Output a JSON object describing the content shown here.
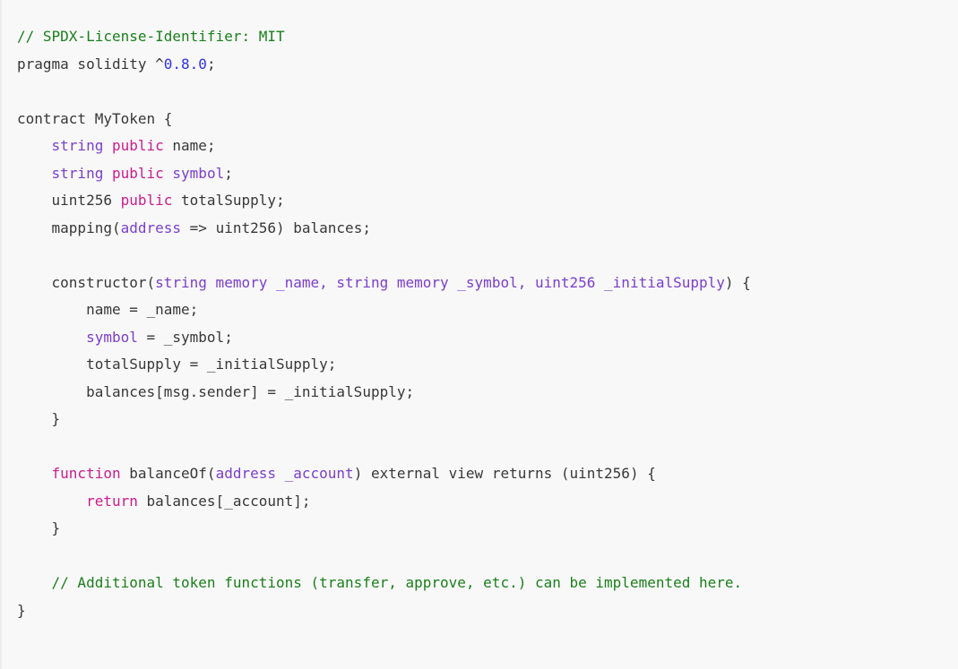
{
  "document": {
    "kind": "code-snippet",
    "language": "solidity",
    "background_color": "#f8f8f8",
    "palette": {
      "plain": "#383838",
      "comment": "#1a7f1a",
      "keyword": "#cc1b8d",
      "type": "#7a3fcc",
      "number": "#3030ee"
    },
    "font_size_px": 16,
    "line_height_px": 30.5,
    "right_clipped": true,
    "lines": [
      {
        "n": 1,
        "indent": 0,
        "text": "// SPDX-License-Identifier: MIT",
        "tokens": [
          {
            "t": "// SPDX-License-Identifier: MIT",
            "c": "cmt"
          }
        ]
      },
      {
        "n": 2,
        "indent": 0,
        "text": "pragma solidity ^0.8.0;",
        "tokens": [
          {
            "t": "pragma solidity ^",
            "c": "pln"
          },
          {
            "t": "0.8.0",
            "c": "num"
          },
          {
            "t": ";",
            "c": "pln"
          }
        ]
      },
      {
        "n": 3,
        "indent": 0,
        "text": "",
        "tokens": []
      },
      {
        "n": 4,
        "indent": 0,
        "text": "contract MyToken {",
        "tokens": [
          {
            "t": "contract MyToken {",
            "c": "pln"
          }
        ]
      },
      {
        "n": 5,
        "indent": 4,
        "text": "    string public name;",
        "tokens": [
          {
            "t": "    ",
            "c": "pln"
          },
          {
            "t": "string",
            "c": "typ"
          },
          {
            "t": " ",
            "c": "pln"
          },
          {
            "t": "public",
            "c": "kw"
          },
          {
            "t": " name;",
            "c": "pln"
          }
        ]
      },
      {
        "n": 6,
        "indent": 4,
        "text": "    string public symbol;",
        "tokens": [
          {
            "t": "    ",
            "c": "pln"
          },
          {
            "t": "string",
            "c": "typ"
          },
          {
            "t": " ",
            "c": "pln"
          },
          {
            "t": "public",
            "c": "kw"
          },
          {
            "t": " ",
            "c": "pln"
          },
          {
            "t": "symbol",
            "c": "typ"
          },
          {
            "t": ";",
            "c": "pln"
          }
        ]
      },
      {
        "n": 7,
        "indent": 4,
        "text": "    uint256 public totalSupply;",
        "tokens": [
          {
            "t": "    uint256 ",
            "c": "pln"
          },
          {
            "t": "public",
            "c": "kw"
          },
          {
            "t": " totalSupply;",
            "c": "pln"
          }
        ]
      },
      {
        "n": 8,
        "indent": 4,
        "text": "    mapping(address => uint256) balances;",
        "tokens": [
          {
            "t": "    mapping(",
            "c": "pln"
          },
          {
            "t": "address",
            "c": "typ"
          },
          {
            "t": " => uint256) balances;",
            "c": "pln"
          }
        ]
      },
      {
        "n": 9,
        "indent": 0,
        "text": "",
        "tokens": []
      },
      {
        "n": 10,
        "indent": 4,
        "text": "    constructor(string memory _name, string memory _symbol, uint256 _initialSupply) {",
        "tokens": [
          {
            "t": "    constructor(",
            "c": "pln"
          },
          {
            "t": "string memory _name",
            "c": "typ"
          },
          {
            "t": ", ",
            "c": "typ"
          },
          {
            "t": "string memory _symbol, uint256 _initialSupply",
            "c": "typ"
          },
          {
            "t": ") {",
            "c": "pln"
          }
        ]
      },
      {
        "n": 11,
        "indent": 8,
        "text": "        name = _name;",
        "tokens": [
          {
            "t": "        name = _name;",
            "c": "pln"
          }
        ]
      },
      {
        "n": 12,
        "indent": 8,
        "text": "        symbol = _symbol;",
        "tokens": [
          {
            "t": "        ",
            "c": "pln"
          },
          {
            "t": "symbol",
            "c": "typ"
          },
          {
            "t": " = _symbol;",
            "c": "pln"
          }
        ]
      },
      {
        "n": 13,
        "indent": 8,
        "text": "        totalSupply = _initialSupply;",
        "tokens": [
          {
            "t": "        totalSupply = _initialSupply;",
            "c": "pln"
          }
        ]
      },
      {
        "n": 14,
        "indent": 8,
        "text": "        balances[msg.sender] = _initialSupply;",
        "tokens": [
          {
            "t": "        balances[msg.sender] = _initialSupply;",
            "c": "pln"
          }
        ]
      },
      {
        "n": 15,
        "indent": 4,
        "text": "    }",
        "tokens": [
          {
            "t": "    }",
            "c": "pln"
          }
        ]
      },
      {
        "n": 16,
        "indent": 0,
        "text": "",
        "tokens": []
      },
      {
        "n": 17,
        "indent": 4,
        "text": "    function balanceOf(address _account) external view returns (uint256) {",
        "tokens": [
          {
            "t": "    ",
            "c": "pln"
          },
          {
            "t": "function",
            "c": "kw"
          },
          {
            "t": " balanceOf(",
            "c": "pln"
          },
          {
            "t": "address _account",
            "c": "typ"
          },
          {
            "t": ") external view returns (uint256) {",
            "c": "pln"
          }
        ]
      },
      {
        "n": 18,
        "indent": 8,
        "text": "        return balances[_account];",
        "tokens": [
          {
            "t": "        ",
            "c": "pln"
          },
          {
            "t": "return",
            "c": "kw"
          },
          {
            "t": " balances[_account];",
            "c": "pln"
          }
        ]
      },
      {
        "n": 19,
        "indent": 4,
        "text": "    }",
        "tokens": [
          {
            "t": "    }",
            "c": "pln"
          }
        ]
      },
      {
        "n": 20,
        "indent": 0,
        "text": "",
        "tokens": []
      },
      {
        "n": 21,
        "indent": 4,
        "text": "    // Additional token functions (transfer, approve, etc.) can be implemented here.",
        "tokens": [
          {
            "t": "    ",
            "c": "pln"
          },
          {
            "t": "// Additional token functions (transfer, approve, etc.) can be implemented here.",
            "c": "cmt"
          }
        ]
      },
      {
        "n": 22,
        "indent": 0,
        "text": "}",
        "tokens": [
          {
            "t": "}",
            "c": "pln"
          }
        ]
      }
    ]
  }
}
